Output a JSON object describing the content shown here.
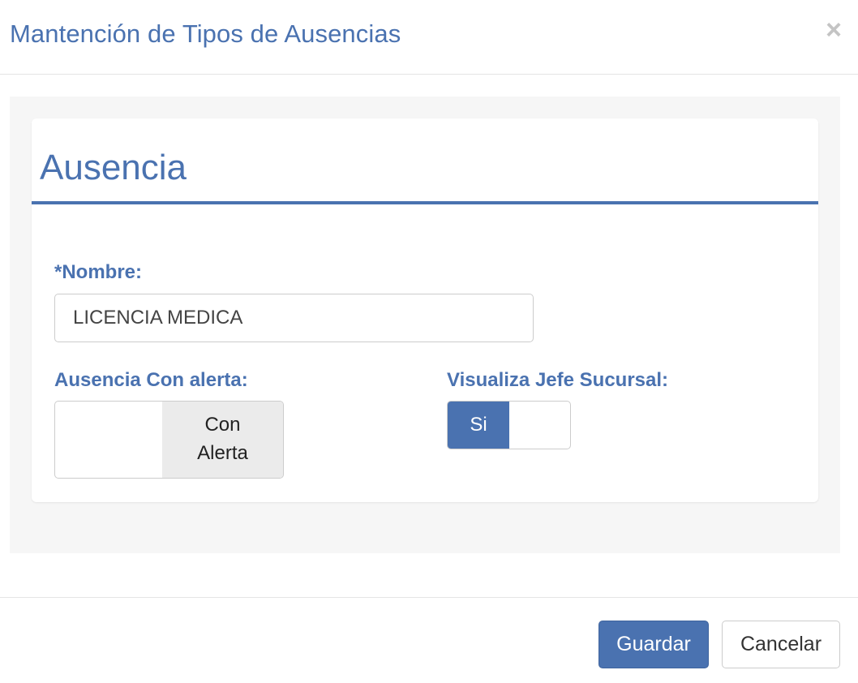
{
  "modal": {
    "title": "Mantención de Tipos de Ausencias",
    "close_label": "×"
  },
  "panel": {
    "title": "Ausencia"
  },
  "form": {
    "nombre_label": "*Nombre:",
    "nombre_value": "LICENCIA MEDICA",
    "alerta_label": "Ausencia Con alerta:",
    "alerta_toggle_line1": "Con",
    "alerta_toggle_line2": "Alerta",
    "jefe_label": "Visualiza Jefe Sucursal:",
    "jefe_toggle_on": "Si"
  },
  "footer": {
    "save_label": "Guardar",
    "cancel_label": "Cancelar"
  },
  "colors": {
    "accent": "#4a72b0",
    "body_bg": "#f6f6f6",
    "toggle_off_bg": "#ebebeb"
  }
}
